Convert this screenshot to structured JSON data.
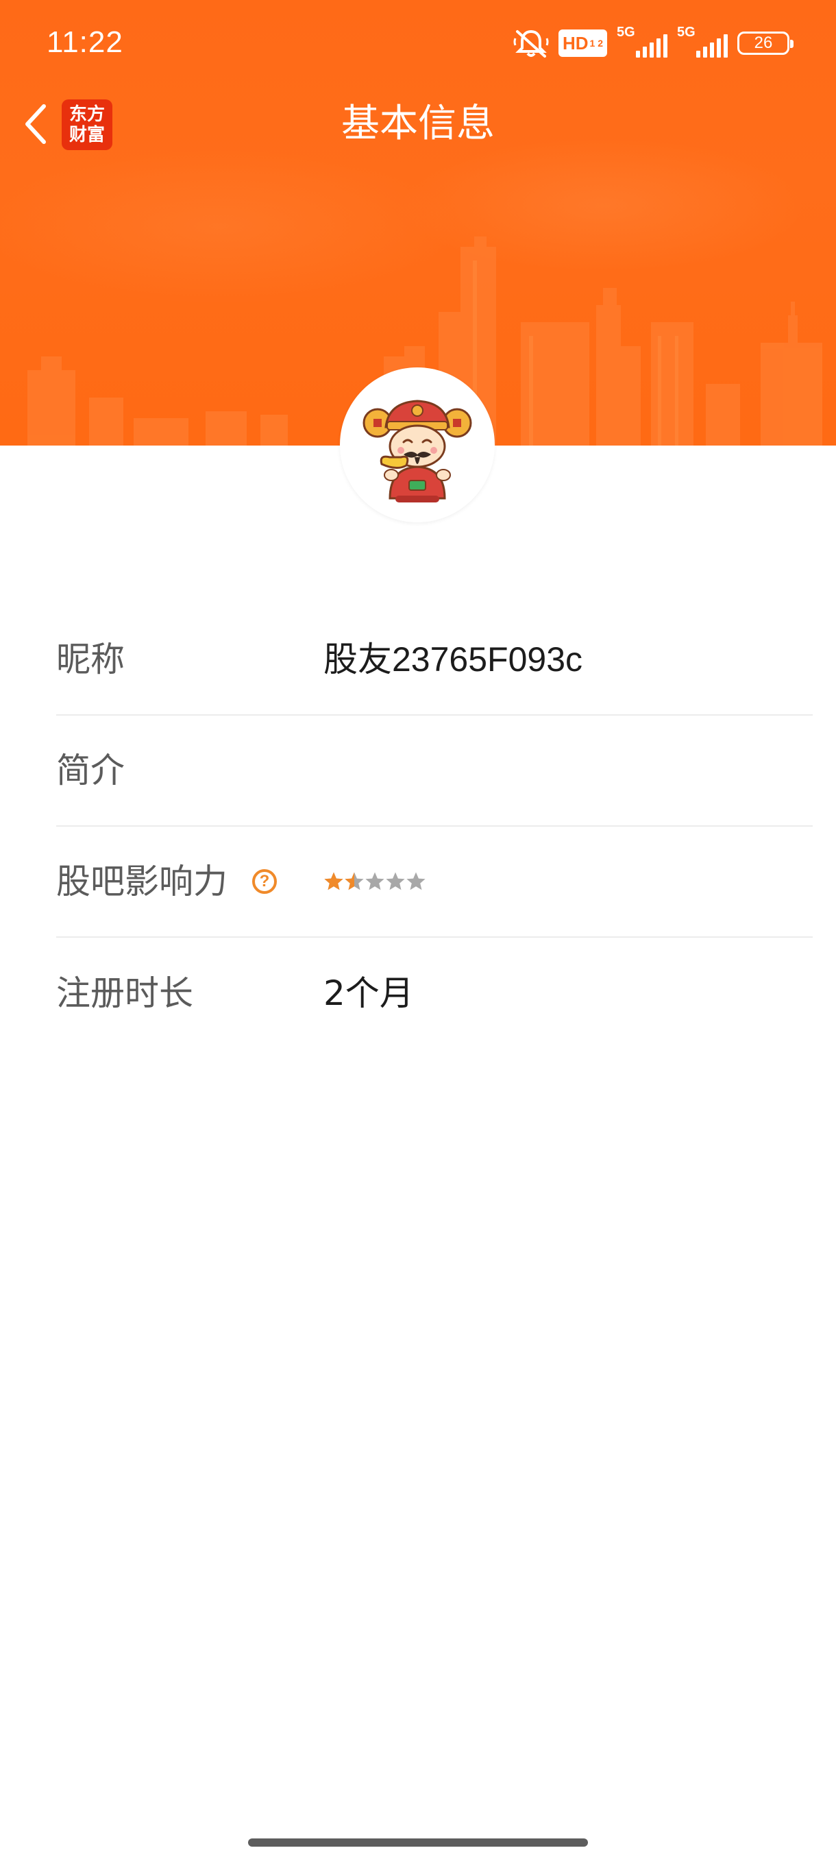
{
  "status_bar": {
    "time": "11:22",
    "hd_label": "HD",
    "hd_sub": "1 2",
    "signal1_label": "5G",
    "signal2_label": "5G",
    "battery": "26",
    "mute_icon": "bell-slash-icon"
  },
  "nav": {
    "back_icon": "chevron-left-icon",
    "app_logo_line1": "东方",
    "app_logo_line2": "财富",
    "title": "基本信息"
  },
  "colors": {
    "header": "#ff6a17",
    "accent": "#f08a2a",
    "star_filled": "#f08a2a",
    "star_empty": "#a8a8a8"
  },
  "profile": {
    "avatar_icon": "god-of-wealth-avatar-icon"
  },
  "info": {
    "nickname": {
      "label": "昵称",
      "value": "股友23765F093c"
    },
    "bio": {
      "label": "简介",
      "value": ""
    },
    "influence": {
      "label": "股吧影响力",
      "help_icon": "question-circle-icon",
      "help_glyph": "?",
      "rating": 1.5,
      "max": 5
    },
    "registered": {
      "label": "注册时长",
      "value": "2个月"
    }
  }
}
